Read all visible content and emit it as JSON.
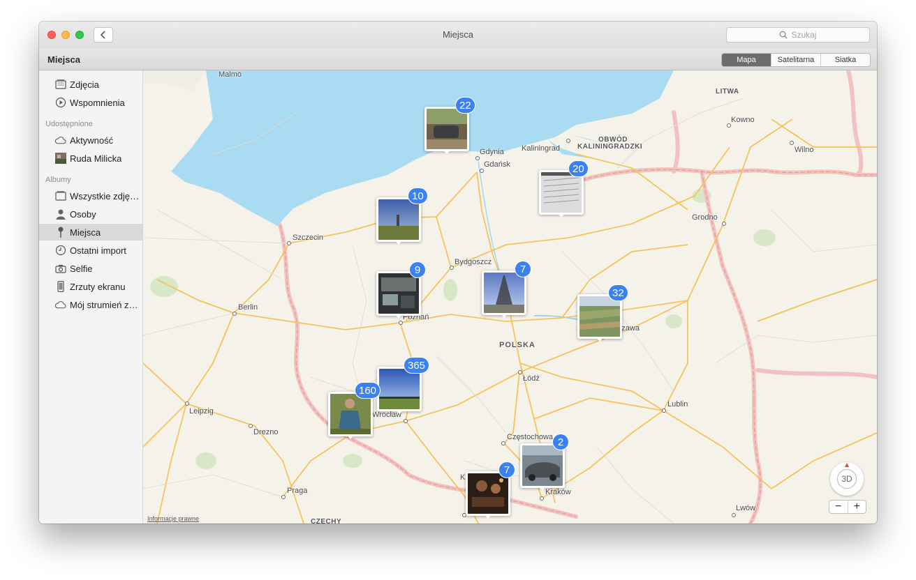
{
  "window": {
    "title": "Miejsca",
    "search_placeholder": "Szukaj",
    "back_icon": "chevron-left-icon"
  },
  "toolbar": {
    "page_title": "Miejsca",
    "view_modes": [
      "Mapa",
      "Satelitarna",
      "Siatka"
    ],
    "active_view_mode": "Mapa"
  },
  "sidebar": {
    "library": [
      {
        "label": "Zdjęcia",
        "icon": "photos-icon"
      },
      {
        "label": "Wspomnienia",
        "icon": "memories-icon"
      }
    ],
    "shared_header": "Udostępnione",
    "shared": [
      {
        "label": "Aktywność",
        "icon": "cloud-icon"
      },
      {
        "label": "Ruda Milicka",
        "icon": "album-thumbnail-icon"
      }
    ],
    "albums_header": "Albumy",
    "albums": [
      {
        "label": "Wszystkie zdjęcia",
        "icon": "all-photos-icon"
      },
      {
        "label": "Osoby",
        "icon": "person-icon"
      },
      {
        "label": "Miejsca",
        "icon": "pin-icon",
        "selected": true
      },
      {
        "label": "Ostatni import",
        "icon": "clock-icon"
      },
      {
        "label": "Selfie",
        "icon": "camera-icon"
      },
      {
        "label": "Zrzuty ekranu",
        "icon": "phone-icon"
      },
      {
        "label": "Mój strumień zdjęć",
        "icon": "cloud-icon"
      }
    ]
  },
  "map": {
    "country_label": "POLSKA",
    "region_labels": [
      "LITWA",
      "OBWÓD",
      "KALININGRADZKI",
      "CZECHY"
    ],
    "cities": [
      "Malmö",
      "Kowno",
      "Gdynia",
      "Kaliningrad",
      "Gdańsk",
      "Wilno",
      "Grodno",
      "Szczecin",
      "Bydgoszcz",
      "Berlin",
      "Poznań",
      "Łódź",
      "Leipzig",
      "Drezno",
      "Lublin",
      "Częstochowa",
      "Kraków",
      "Praga",
      "Lwów",
      "Wrocław",
      "Warszawa",
      "Katowice"
    ],
    "photo_clusters": [
      {
        "count": "22",
        "place": "Gdynia"
      },
      {
        "count": "20",
        "place": "Kaliningrad"
      },
      {
        "count": "10",
        "place": "Szczecin"
      },
      {
        "count": "9",
        "place": "Poznań"
      },
      {
        "count": "7",
        "place": "Bydgoszcz"
      },
      {
        "count": "32",
        "place": "Warszawa"
      },
      {
        "count": "365",
        "place": "Wrocław"
      },
      {
        "count": "160",
        "place": "Wrocław"
      },
      {
        "count": "2",
        "place": "Częstochowa"
      },
      {
        "count": "7",
        "place": "Katowice"
      }
    ],
    "legal_link": "Informacje prawne",
    "compass_label": "3D",
    "zoom_out": "−",
    "zoom_in": "+",
    "colors": {
      "water": "#a9dcf2",
      "land": "#f5f2ea",
      "road": "#f6c35b",
      "border": "#f2c2c0",
      "badge": "#3b82f0"
    }
  }
}
